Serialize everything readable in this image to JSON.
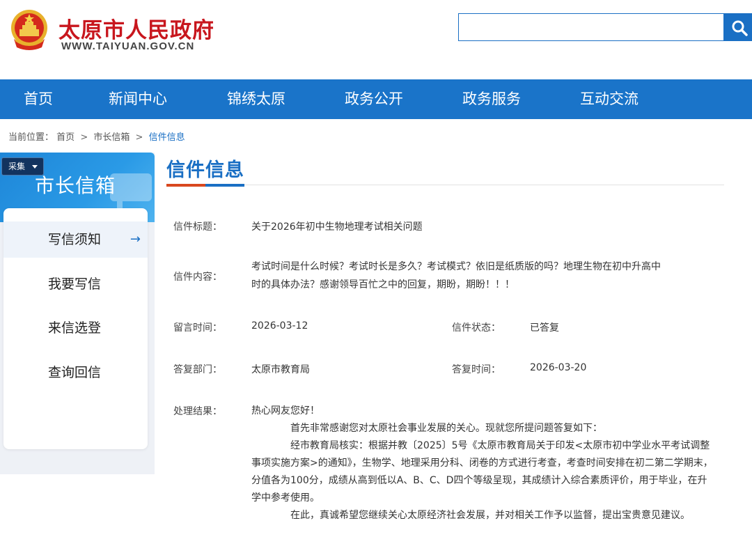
{
  "header": {
    "site_name": "太原市人民政府",
    "site_url": "WWW.TAIYUAN.GOV.CN",
    "search": {
      "placeholder": "",
      "value": ""
    }
  },
  "nav": {
    "items": [
      "首页",
      "新闻中心",
      "锦绣太原",
      "政务公开",
      "政务服务",
      "互动交流"
    ]
  },
  "breadcrumb": {
    "prefix": "当前位置：",
    "items": [
      "首页",
      "市长信箱",
      "信件信息"
    ],
    "separator": ">"
  },
  "sidebar": {
    "badge": "采集",
    "title": "市长信箱",
    "items": [
      {
        "label": "写信须知",
        "active": true,
        "arrow": "→"
      },
      {
        "label": "我要写信",
        "active": false
      },
      {
        "label": "来信选登",
        "active": false
      },
      {
        "label": "查询回信",
        "active": false
      }
    ]
  },
  "main": {
    "title": "信件信息",
    "fields": {
      "letter_title_label": "信件标题：",
      "letter_title": "关于2026年初中生物地理考试相关问题",
      "content_label": "信件内容：",
      "content_line1": "考试时间是什么时候？考试时长是多久？考试模式？依旧是纸质版的吗？地理生物在初中升高中",
      "content_line2": "时的具体办法？感谢领导百忙之中的回复，期盼，期盼！！！",
      "message_time_label": "留言时间：",
      "message_time": "2026-03-12",
      "status_label": "信件状态：",
      "status": "已答复",
      "reply_dept_label": "答复部门：",
      "reply_dept": "太原市教育局",
      "reply_time_label": "答复时间：",
      "reply_time": "2026-03-20",
      "result_label": "处理结果："
    },
    "result": {
      "greeting": "热心网友您好！",
      "p1": "首先非常感谢您对太原社会事业发展的关心。现就您所提问题答复如下：",
      "p2": "经市教育局核实：根据并教〔2025〕5号《太原市教育局关于印发<太原市初中学业水平考试调整事项实施方案>的通知》，生物学、地理采用分科、闭卷的方式进行考查，考查时间安排在初二第二学期末，分值各为100分，成绩从高到低以A、B、C、D四个等级呈现，其成绩计入综合素质评价，用于毕业，在升学中参考使用。",
      "p3": "在此，真诚希望您继续关心太原经济社会发展，并对相关工作予以监督，提出宝贵意见建议。"
    }
  },
  "colors": {
    "brand_blue": "#1a74c9",
    "brand_red": "#c8161d",
    "accent_orange": "#d9481f"
  }
}
